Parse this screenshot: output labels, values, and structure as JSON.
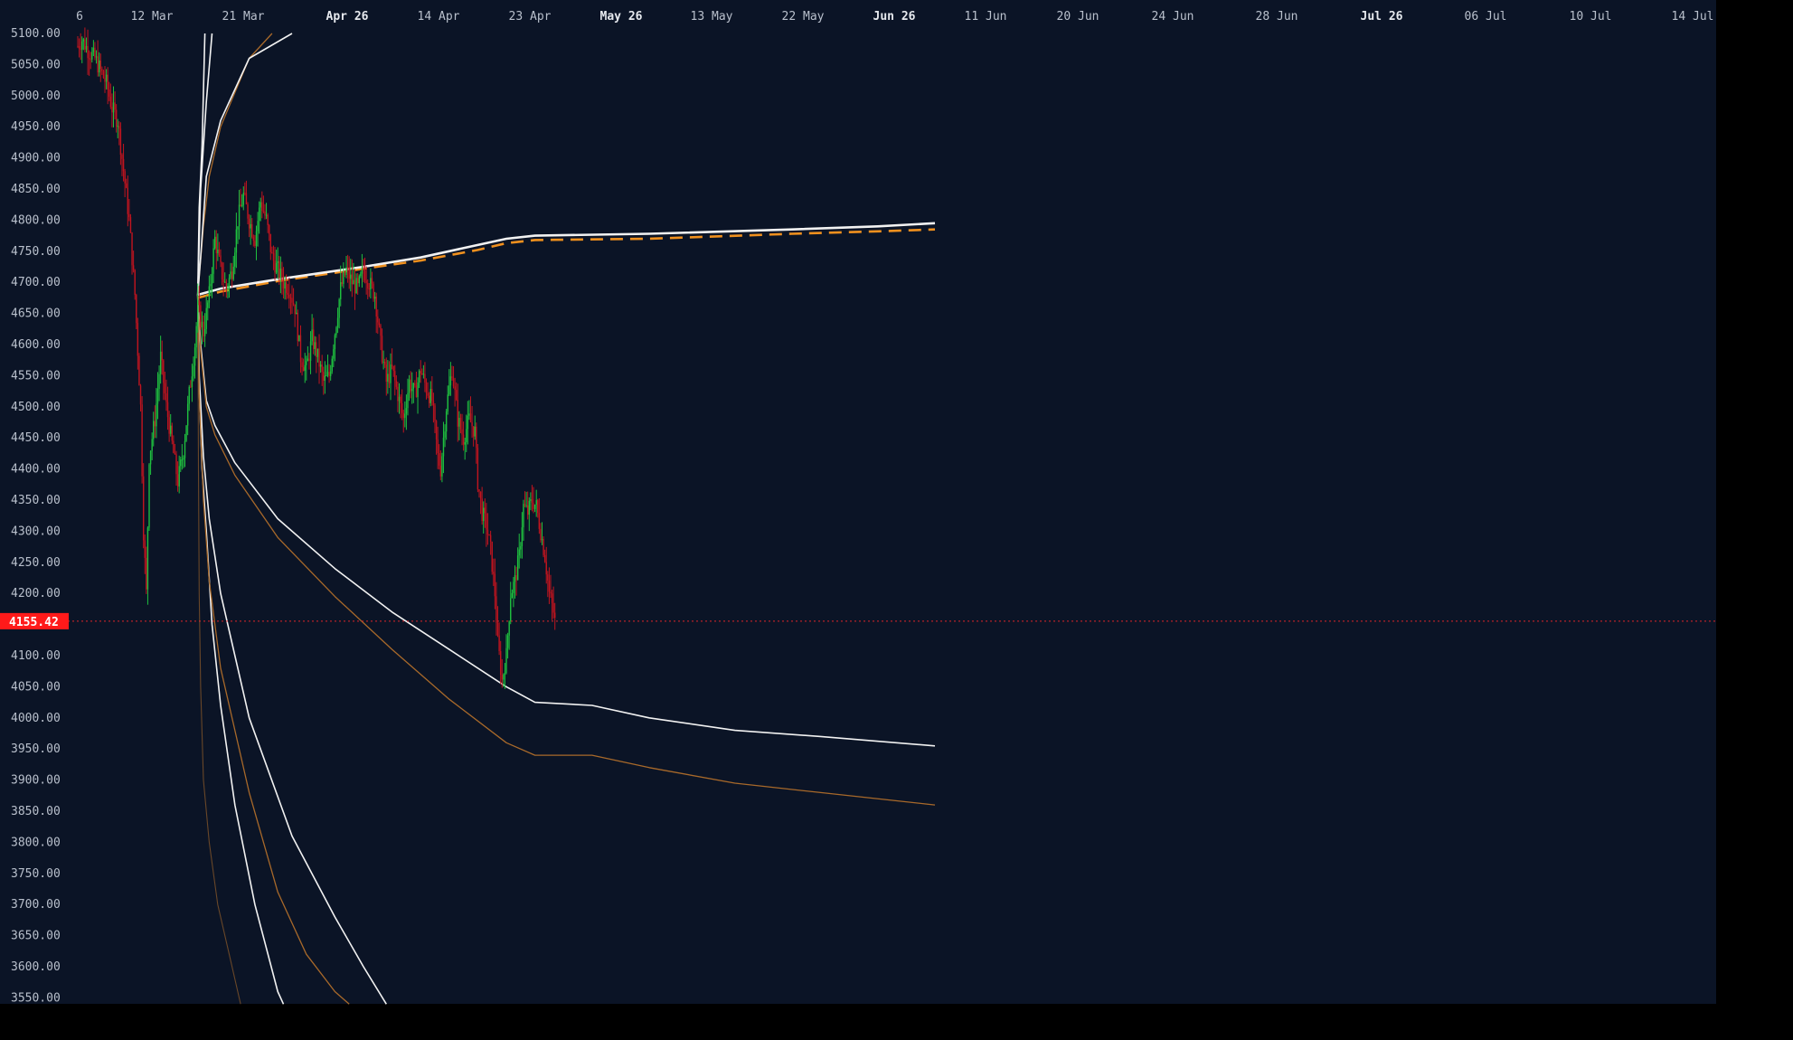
{
  "colors": {
    "background": "#0b1426",
    "outer": "#000000",
    "up_candle": "#1fbf3f",
    "down_candle": "#c0141f",
    "axis_text": "#b9c0cc",
    "axis_text_bold": "#e6e9ee",
    "white_band": "#f2f2f2",
    "orange_band": "#a8692a",
    "orange_dashed": "#f0901e",
    "price_line": "#e0262b",
    "price_tag_bg": "#ff1a1a",
    "price_tag_text": "#ffffff"
  },
  "chart_data": {
    "type": "candlestick",
    "title": "",
    "xlabel": "",
    "ylabel": "",
    "ylim": [
      3540,
      5100
    ],
    "grid": false,
    "y_ticks": [
      "5100.00",
      "5050.00",
      "5000.00",
      "4950.00",
      "4900.00",
      "4850.00",
      "4800.00",
      "4750.00",
      "4700.00",
      "4650.00",
      "4600.00",
      "4550.00",
      "4500.00",
      "4450.00",
      "4400.00",
      "4350.00",
      "4300.00",
      "4250.00",
      "4200.00",
      "4150.00",
      "4100.00",
      "4050.00",
      "4000.00",
      "3950.00",
      "3900.00",
      "3850.00",
      "3800.00",
      "3750.00",
      "3700.00",
      "3650.00",
      "3600.00",
      "3550.00"
    ],
    "y_tick_values": [
      5100,
      5050,
      5000,
      4950,
      4900,
      4850,
      4800,
      4750,
      4700,
      4650,
      4600,
      4550,
      4500,
      4450,
      4400,
      4350,
      4300,
      4250,
      4200,
      4150,
      4100,
      4050,
      4000,
      3950,
      3900,
      3850,
      3800,
      3750,
      3700,
      3650,
      3600,
      3550
    ],
    "x_ticks": [
      {
        "label": "6",
        "bold": false
      },
      {
        "label": "12 Mar",
        "bold": false
      },
      {
        "label": "21 Mar",
        "bold": false
      },
      {
        "label": "Apr 26",
        "bold": true
      },
      {
        "label": "14 Apr",
        "bold": false
      },
      {
        "label": "23 Apr",
        "bold": false
      },
      {
        "label": "May 26",
        "bold": true
      },
      {
        "label": "13 May",
        "bold": false
      },
      {
        "label": "22 May",
        "bold": false
      },
      {
        "label": "Jun 26",
        "bold": true
      },
      {
        "label": "11 Jun",
        "bold": false
      },
      {
        "label": "20 Jun",
        "bold": false
      },
      {
        "label": "24 Jun",
        "bold": false
      },
      {
        "label": "28 Jun",
        "bold": false
      },
      {
        "label": "Jul 26",
        "bold": true
      },
      {
        "label": "06 Jul",
        "bold": false
      },
      {
        "label": "10 Jul",
        "bold": false
      },
      {
        "label": "14 Jul",
        "bold": false
      }
    ],
    "current_price": {
      "value": 4155.42,
      "label": "4155.42"
    },
    "price_path": [
      [
        0,
        5080
      ],
      [
        3,
        5090
      ],
      [
        8,
        5070
      ],
      [
        12,
        5060
      ],
      [
        16,
        5040
      ],
      [
        20,
        5020
      ],
      [
        24,
        4980
      ],
      [
        28,
        4960
      ],
      [
        32,
        4880
      ],
      [
        36,
        4800
      ],
      [
        40,
        4680
      ],
      [
        44,
        4500
      ],
      [
        46,
        4300
      ],
      [
        48,
        4200
      ],
      [
        50,
        4420
      ],
      [
        54,
        4480
      ],
      [
        58,
        4580
      ],
      [
        62,
        4500
      ],
      [
        66,
        4440
      ],
      [
        70,
        4380
      ],
      [
        74,
        4430
      ],
      [
        78,
        4520
      ],
      [
        82,
        4600
      ],
      [
        84,
        4660
      ],
      [
        88,
        4620
      ],
      [
        92,
        4680
      ],
      [
        96,
        4770
      ],
      [
        100,
        4720
      ],
      [
        104,
        4690
      ],
      [
        108,
        4720
      ],
      [
        112,
        4800
      ],
      [
        116,
        4840
      ],
      [
        120,
        4800
      ],
      [
        124,
        4770
      ],
      [
        128,
        4830
      ],
      [
        132,
        4800
      ],
      [
        136,
        4740
      ],
      [
        140,
        4720
      ],
      [
        144,
        4700
      ],
      [
        148,
        4690
      ],
      [
        152,
        4660
      ],
      [
        156,
        4580
      ],
      [
        160,
        4560
      ],
      [
        164,
        4610
      ],
      [
        168,
        4580
      ],
      [
        172,
        4540
      ],
      [
        176,
        4550
      ],
      [
        180,
        4620
      ],
      [
        184,
        4690
      ],
      [
        188,
        4720
      ],
      [
        192,
        4700
      ],
      [
        196,
        4690
      ],
      [
        200,
        4720
      ],
      [
        204,
        4700
      ],
      [
        208,
        4680
      ],
      [
        212,
        4600
      ],
      [
        216,
        4540
      ],
      [
        220,
        4560
      ],
      [
        224,
        4520
      ],
      [
        228,
        4480
      ],
      [
        232,
        4540
      ],
      [
        236,
        4520
      ],
      [
        240,
        4560
      ],
      [
        244,
        4530
      ],
      [
        248,
        4510
      ],
      [
        252,
        4420
      ],
      [
        254,
        4400
      ],
      [
        258,
        4500
      ],
      [
        262,
        4560
      ],
      [
        266,
        4480
      ],
      [
        270,
        4450
      ],
      [
        274,
        4480
      ],
      [
        278,
        4460
      ],
      [
        280,
        4380
      ],
      [
        283,
        4330
      ],
      [
        286,
        4310
      ],
      [
        289,
        4270
      ],
      [
        292,
        4200
      ],
      [
        294,
        4120
      ],
      [
        297,
        4060
      ],
      [
        300,
        4100
      ],
      [
        303,
        4200
      ],
      [
        306,
        4220
      ],
      [
        309,
        4260
      ],
      [
        312,
        4340
      ],
      [
        315,
        4330
      ],
      [
        318,
        4350
      ],
      [
        321,
        4340
      ],
      [
        324,
        4300
      ],
      [
        327,
        4260
      ],
      [
        330,
        4200
      ],
      [
        333,
        4170
      ],
      [
        334,
        4155
      ]
    ],
    "bands": [
      {
        "color": "white",
        "dashed": false,
        "points": [
          [
            84,
            4680
          ],
          [
            100,
            4690
          ],
          [
            140,
            4705
          ],
          [
            200,
            4725
          ],
          [
            240,
            4740
          ],
          [
            280,
            4760
          ],
          [
            300,
            4770
          ],
          [
            320,
            4775
          ],
          [
            400,
            4778
          ],
          [
            500,
            4785
          ],
          [
            560,
            4790
          ],
          [
            600,
            4795
          ]
        ]
      },
      {
        "color": "orange-dashed",
        "dashed": true,
        "points": [
          [
            84,
            4675
          ],
          [
            100,
            4685
          ],
          [
            140,
            4702
          ],
          [
            200,
            4722
          ],
          [
            240,
            4735
          ],
          [
            280,
            4752
          ],
          [
            300,
            4763
          ],
          [
            320,
            4768
          ],
          [
            400,
            4770
          ],
          [
            500,
            4778
          ],
          [
            560,
            4782
          ],
          [
            600,
            4785
          ]
        ]
      },
      {
        "color": "white",
        "dashed": false,
        "points": [
          [
            84,
            4680
          ],
          [
            86,
            4600
          ],
          [
            90,
            4510
          ],
          [
            96,
            4470
          ],
          [
            110,
            4410
          ],
          [
            140,
            4320
          ],
          [
            180,
            4240
          ],
          [
            220,
            4170
          ],
          [
            260,
            4110
          ],
          [
            300,
            4050
          ],
          [
            320,
            4025
          ],
          [
            360,
            4020
          ],
          [
            400,
            4000
          ],
          [
            460,
            3980
          ],
          [
            520,
            3970
          ],
          [
            600,
            3955
          ]
        ]
      },
      {
        "color": "orange",
        "dashed": false,
        "points": [
          [
            84,
            4680
          ],
          [
            86,
            4590
          ],
          [
            90,
            4500
          ],
          [
            96,
            4455
          ],
          [
            110,
            4390
          ],
          [
            140,
            4290
          ],
          [
            180,
            4195
          ],
          [
            220,
            4110
          ],
          [
            260,
            4030
          ],
          [
            300,
            3960
          ],
          [
            320,
            3940
          ],
          [
            360,
            3940
          ],
          [
            400,
            3920
          ],
          [
            460,
            3895
          ],
          [
            520,
            3880
          ],
          [
            600,
            3860
          ]
        ]
      },
      {
        "color": "white",
        "dashed": false,
        "points": [
          [
            84,
            4680
          ],
          [
            85,
            4550
          ],
          [
            88,
            4420
          ],
          [
            92,
            4320
          ],
          [
            100,
            4200
          ],
          [
            120,
            4000
          ],
          [
            150,
            3810
          ],
          [
            180,
            3680
          ],
          [
            200,
            3600
          ],
          [
            216,
            3540
          ]
        ]
      },
      {
        "color": "white",
        "dashed": false,
        "points": [
          [
            84,
            4680
          ],
          [
            85,
            4530
          ],
          [
            87,
            4400
          ],
          [
            90,
            4300
          ],
          [
            94,
            4150
          ],
          [
            100,
            4020
          ],
          [
            110,
            3860
          ],
          [
            124,
            3700
          ],
          [
            140,
            3560
          ],
          [
            144,
            3540
          ]
        ]
      },
      {
        "color": "orange",
        "dashed": false,
        "points": [
          [
            84,
            4680
          ],
          [
            85,
            4520
          ],
          [
            88,
            4350
          ],
          [
            92,
            4220
          ],
          [
            100,
            4080
          ],
          [
            120,
            3880
          ],
          [
            140,
            3720
          ],
          [
            160,
            3620
          ],
          [
            180,
            3560
          ],
          [
            190,
            3540
          ]
        ]
      },
      {
        "color": "orange-faint",
        "dashed": false,
        "points": [
          [
            84,
            4680
          ],
          [
            84.5,
            4400
          ],
          [
            85,
            4200
          ],
          [
            86,
            4050
          ],
          [
            88,
            3900
          ],
          [
            92,
            3800
          ],
          [
            98,
            3700
          ],
          [
            106,
            3620
          ],
          [
            114,
            3540
          ]
        ]
      },
      {
        "color": "white",
        "dashed": false,
        "points": [
          [
            84,
            4680
          ],
          [
            85,
            4820
          ],
          [
            87,
            4920
          ],
          [
            89,
            5100
          ]
        ]
      },
      {
        "color": "white",
        "dashed": false,
        "points": [
          [
            84,
            4680
          ],
          [
            86,
            4850
          ],
          [
            90,
            4990
          ],
          [
            94,
            5100
          ]
        ]
      },
      {
        "color": "orange",
        "dashed": false,
        "points": [
          [
            84,
            4680
          ],
          [
            88,
            4790
          ],
          [
            92,
            4870
          ],
          [
            100,
            4950
          ],
          [
            120,
            5060
          ],
          [
            136,
            5100
          ]
        ]
      },
      {
        "color": "white",
        "dashed": false,
        "points": [
          [
            84,
            4680
          ],
          [
            86,
            4740
          ],
          [
            90,
            4870
          ],
          [
            100,
            4960
          ],
          [
            120,
            5060
          ],
          [
            150,
            5100
          ]
        ]
      }
    ]
  }
}
